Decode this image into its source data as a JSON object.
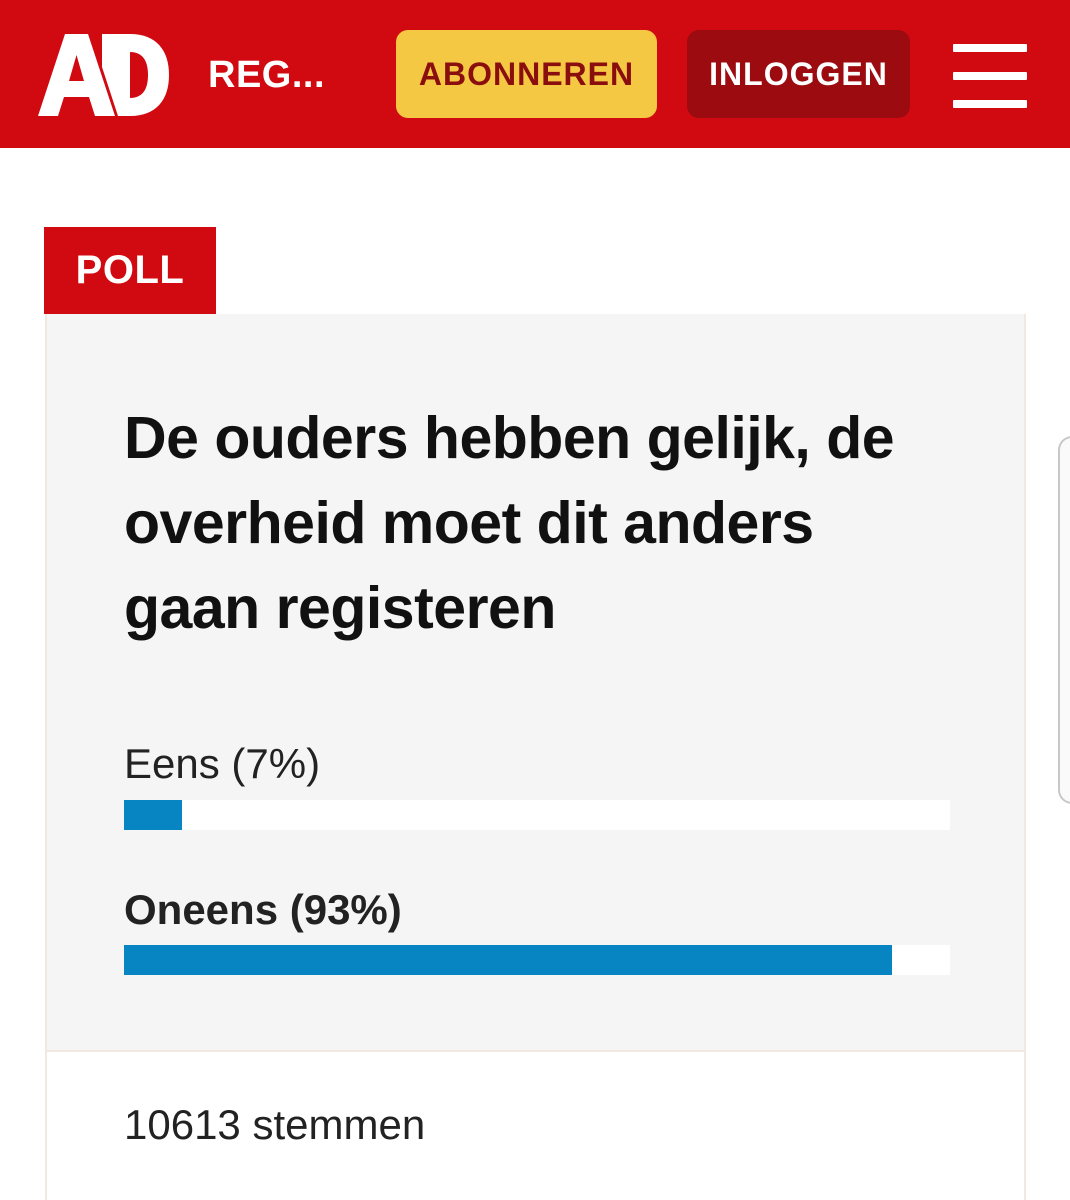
{
  "header": {
    "logo_text": "AD",
    "section_name": "REG...",
    "subscribe_label": "ABONNEREN",
    "login_label": "INLOGGEN",
    "menu_icon": "hamburger-menu-icon"
  },
  "poll": {
    "badge": "POLL",
    "question": "De ouders hebben gelijk, de overheid moet dit anders gaan registeren",
    "options": [
      {
        "label": "Eens (7%)",
        "percent": 7,
        "bold": false
      },
      {
        "label": "Oneens (93%)",
        "percent": 93,
        "bold": true
      }
    ],
    "votes": "10613 stemmen"
  },
  "colors": {
    "brand_red": "#d10a11",
    "subscribe_yellow": "#f5c843",
    "login_dark_red": "#9b0b10",
    "bar_blue": "#0784c2"
  }
}
